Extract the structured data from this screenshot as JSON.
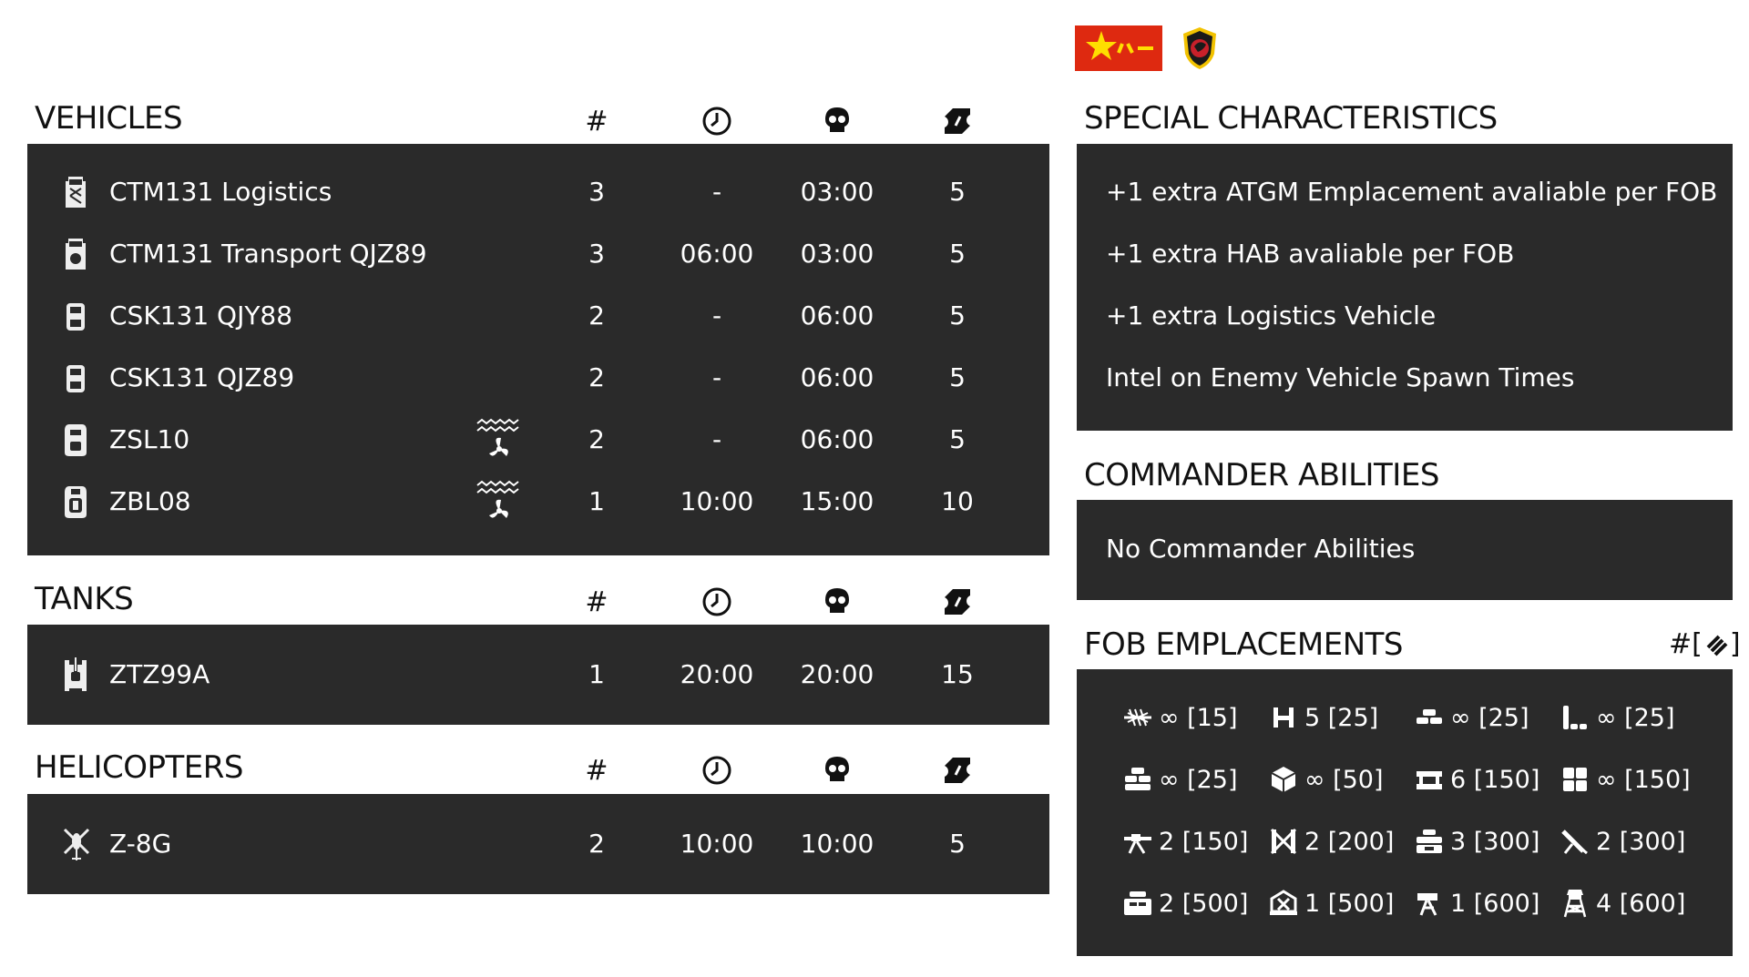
{
  "faction": {
    "flag_icon": "china-pla-flag-icon",
    "emblem_icon": "faction-unit-emblem-icon",
    "flag_colors": {
      "red": "#de2910",
      "yellow": "#ffde00"
    }
  },
  "column_headers": {
    "count": "#",
    "respawn_icon": "clock-icon",
    "delay_icon": "skull-icon",
    "tickets_icon": "ticket-icon"
  },
  "vehicles": {
    "title": "VEHICLES",
    "rows": [
      {
        "name": "CTM131 Logistics",
        "icon": "logistics-truck-icon",
        "amphibious": false,
        "count": "3",
        "respawn": "-",
        "delay": "03:00",
        "tickets": "5"
      },
      {
        "name": "CTM131 Transport QJZ89",
        "icon": "transport-truck-icon",
        "amphibious": false,
        "count": "3",
        "respawn": "06:00",
        "delay": "03:00",
        "tickets": "5"
      },
      {
        "name": "CSK131 QJY88",
        "icon": "light-vehicle-icon",
        "amphibious": false,
        "count": "2",
        "respawn": "-",
        "delay": "06:00",
        "tickets": "5"
      },
      {
        "name": "CSK131 QJZ89",
        "icon": "light-vehicle-icon",
        "amphibious": false,
        "count": "2",
        "respawn": "-",
        "delay": "06:00",
        "tickets": "5"
      },
      {
        "name": "ZSL10",
        "icon": "apc-icon",
        "amphibious": true,
        "count": "2",
        "respawn": "-",
        "delay": "06:00",
        "tickets": "5"
      },
      {
        "name": "ZBL08",
        "icon": "ifv-icon",
        "amphibious": true,
        "count": "1",
        "respawn": "10:00",
        "delay": "15:00",
        "tickets": "10"
      }
    ]
  },
  "tanks": {
    "title": "TANKS",
    "rows": [
      {
        "name": "ZTZ99A",
        "icon": "tank-icon",
        "amphibious": false,
        "count": "1",
        "respawn": "20:00",
        "delay": "20:00",
        "tickets": "15"
      }
    ]
  },
  "helicopters": {
    "title": "HELICOPTERS",
    "rows": [
      {
        "name": "Z-8G",
        "icon": "helicopter-icon",
        "amphibious": false,
        "count": "2",
        "respawn": "10:00",
        "delay": "10:00",
        "tickets": "5"
      }
    ]
  },
  "special_characteristics": {
    "title": "SPECIAL CHARACTERISTICS",
    "items": [
      "+1 extra ATGM Emplacement avaliable per FOB",
      "+1 extra HAB avaliable per FOB",
      "+1 extra Logistics Vehicle",
      "Intel on Enemy Vehicle Spawn Times"
    ]
  },
  "commander_abilities": {
    "title": "COMMANDER ABILITIES",
    "items": [
      "No Commander Abilities"
    ]
  },
  "fob_emplacements": {
    "title": "FOB EMPLACEMENTS",
    "legend_text": "#[",
    "legend_close": "]",
    "legend_icon": "construction-points-icon",
    "items": [
      {
        "icon": "razorwire-icon",
        "text": "∞ [15]"
      },
      {
        "icon": "tank-trap-icon",
        "text": "5 [25]"
      },
      {
        "icon": "sandbag-wall-icon",
        "text": "∞ [25]"
      },
      {
        "icon": "sandbag-corner-icon",
        "text": "∞ [25]"
      },
      {
        "icon": "sandbag-bunker-icon",
        "text": "∞ [25]"
      },
      {
        "icon": "ammo-crate-icon",
        "text": "∞ [50]"
      },
      {
        "icon": "hesco-barrier-icon",
        "text": "6 [150]"
      },
      {
        "icon": "hesco-wall-icon",
        "text": "∞ [150]"
      },
      {
        "icon": "hmg-emplacement-icon",
        "text": "2 [150]"
      },
      {
        "icon": "at-launcher-icon",
        "text": "2 [200]"
      },
      {
        "icon": "bunker-icon",
        "text": "3 [300]"
      },
      {
        "icon": "mortar-icon",
        "text": "2 [300]"
      },
      {
        "icon": "large-bunker-icon",
        "text": "2 [500]"
      },
      {
        "icon": "repair-station-icon",
        "text": "1 [500]"
      },
      {
        "icon": "atgm-emplacement-icon",
        "text": "1 [600]"
      },
      {
        "icon": "watchtower-icon",
        "text": "4 [600]"
      }
    ]
  }
}
